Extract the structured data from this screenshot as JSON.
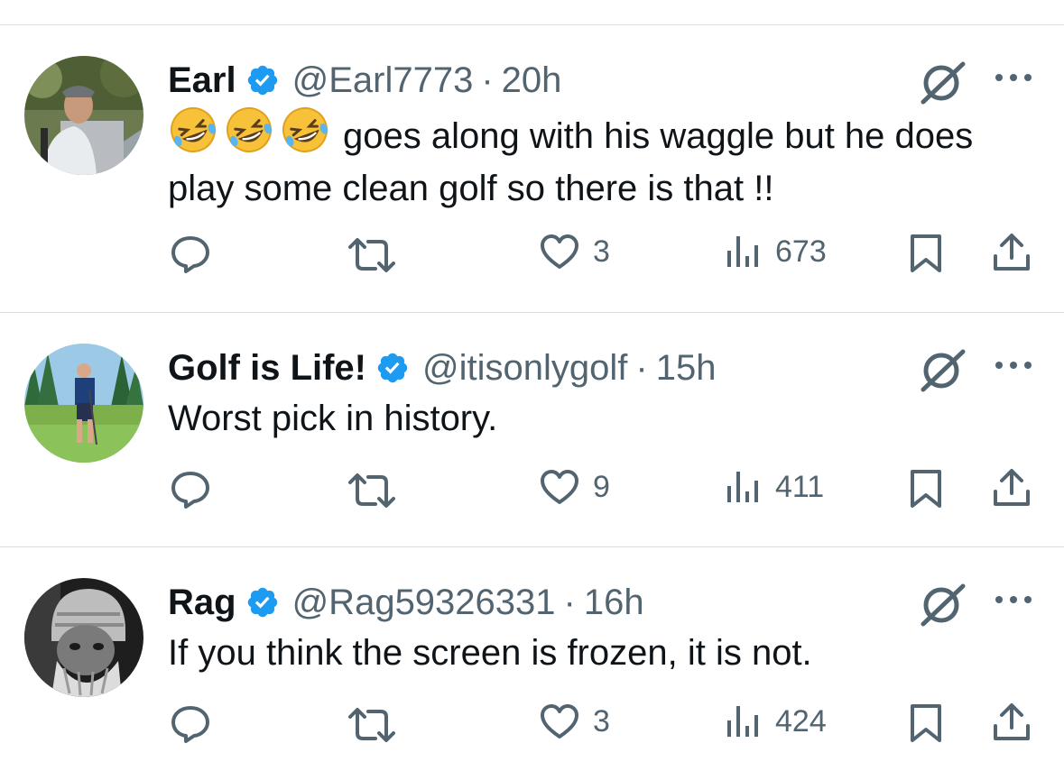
{
  "colors": {
    "text": "#0f1419",
    "secondary": "#536471",
    "verified": "#1d9bf0",
    "divider": "#dcdfe2",
    "background": "#ffffff"
  },
  "icons": [
    "verified-badge-icon",
    "grok-icon",
    "more-icon",
    "reply-icon",
    "retweet-icon",
    "like-icon",
    "views-icon",
    "bookmark-icon",
    "share-icon",
    "rofl-emoji"
  ],
  "tweets": [
    {
      "name": "Earl",
      "handle": "@Earl7773",
      "separator": "·",
      "time": "20h",
      "emoji": [
        "🤣",
        "🤣",
        "🤣"
      ],
      "text": "goes along with his waggle but he does play some clean golf so there is that !!",
      "likes": "3",
      "views": "673"
    },
    {
      "name": "Golf is Life!",
      "handle": "@itisonlygolf",
      "separator": "·",
      "time": "15h",
      "text": "Worst pick in history.",
      "likes": "9",
      "views": "411"
    },
    {
      "name": "Rag",
      "handle": "@Rag59326331",
      "separator": "·",
      "time": "16h",
      "text": "If you think the screen is frozen, it is not.",
      "likes": "3",
      "views": "424"
    }
  ]
}
